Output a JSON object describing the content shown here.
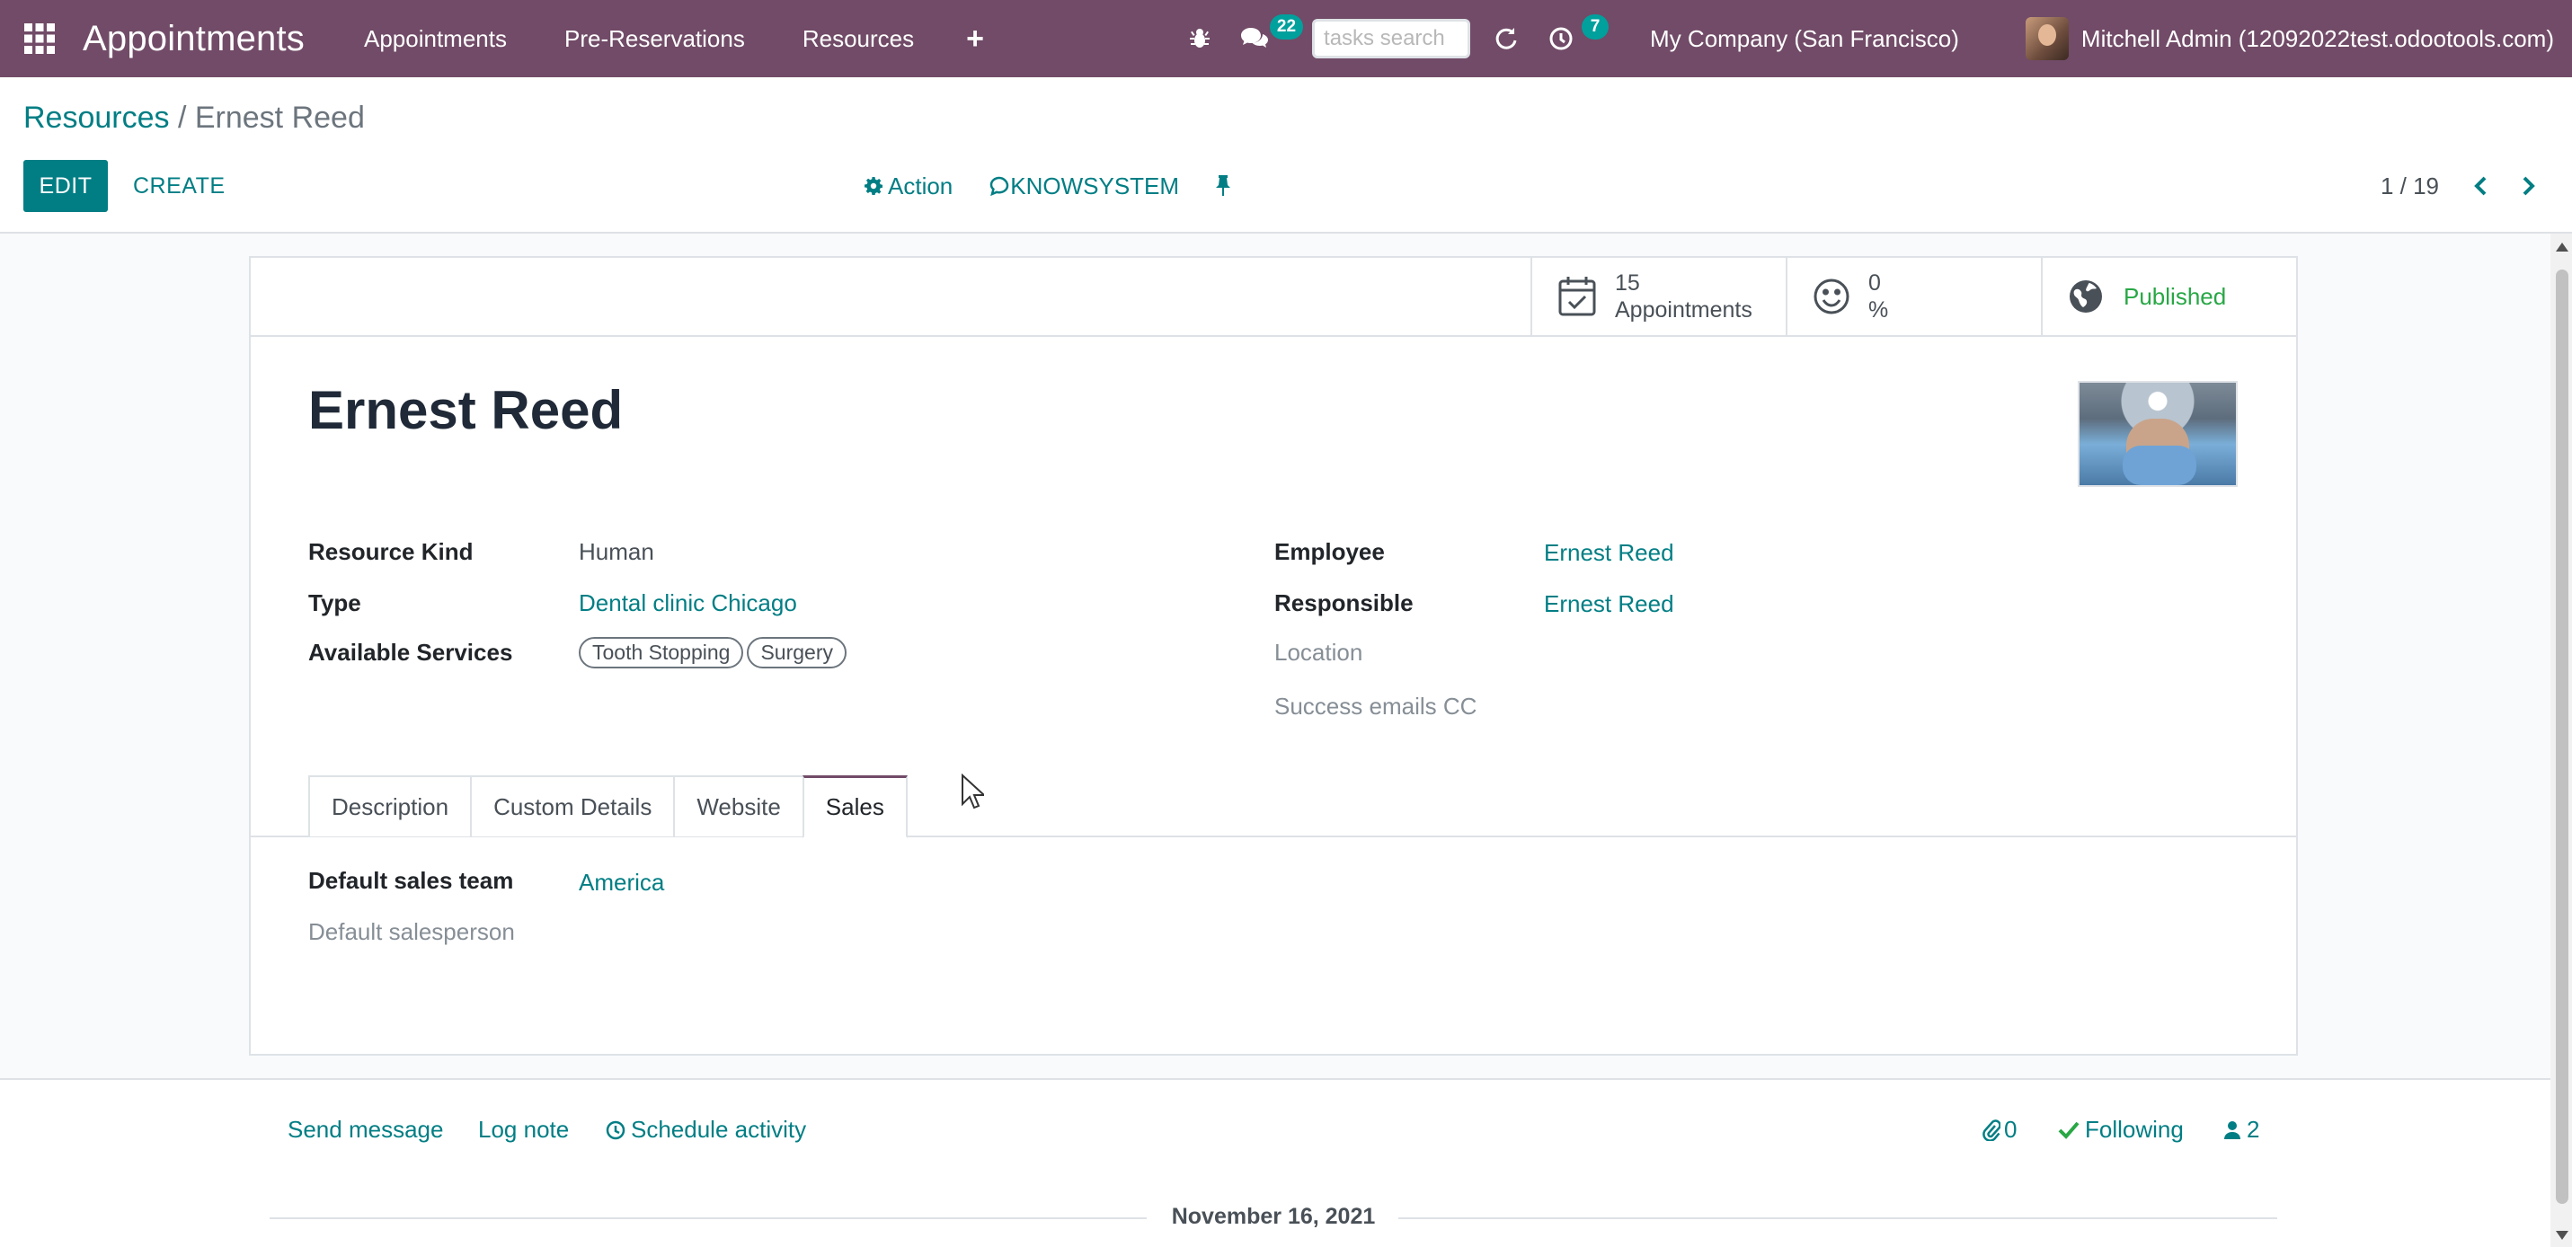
{
  "navbar": {
    "app_title": "Appointments",
    "menu": [
      "Appointments",
      "Pre-Reservations",
      "Resources"
    ],
    "messages_count": "22",
    "tasks_placeholder": "tasks search",
    "activities_count": "7",
    "company": "My Company (San Francisco)",
    "user": "Mitchell Admin (12092022test.odootools.com)"
  },
  "control": {
    "breadcrumb_parent": "Resources",
    "breadcrumb_sep": " / ",
    "breadcrumb_current": "Ernest Reed",
    "edit_label": "EDIT",
    "create_label": "CREATE",
    "action_label": "Action",
    "knowsystem_label": "KNOWSYSTEM",
    "pager": "1 / 19"
  },
  "stats": {
    "appointments_count": "15",
    "appointments_label": "Appointments",
    "rating_value": "0",
    "rating_unit": "%",
    "published_label": "Published"
  },
  "record": {
    "name": "Ernest Reed",
    "left_fields": {
      "resource_kind_label": "Resource Kind",
      "resource_kind_value": "Human",
      "type_label": "Type",
      "type_value": "Dental clinic Chicago",
      "services_label": "Available Services",
      "services": [
        "Tooth Stopping",
        "Surgery"
      ]
    },
    "right_fields": {
      "employee_label": "Employee",
      "employee_value": "Ernest Reed",
      "responsible_label": "Responsible",
      "responsible_value": "Ernest Reed",
      "location_label": "Location",
      "success_emails_label": "Success emails CC"
    }
  },
  "tabs": [
    "Description",
    "Custom Details",
    "Website",
    "Sales"
  ],
  "sales_tab": {
    "sales_team_label": "Default sales team",
    "sales_team_value": "America",
    "salesperson_label": "Default salesperson"
  },
  "chatter": {
    "send_message": "Send message",
    "log_note": "Log note",
    "schedule_activity": "Schedule activity",
    "attachments_count": "0",
    "following_label": "Following",
    "followers_count": "2",
    "date_separator": "November 16, 2021"
  },
  "colors": {
    "navbar": "#714b67",
    "primary": "#017e84",
    "success": "#28a745",
    "badge": "#00a09d"
  }
}
